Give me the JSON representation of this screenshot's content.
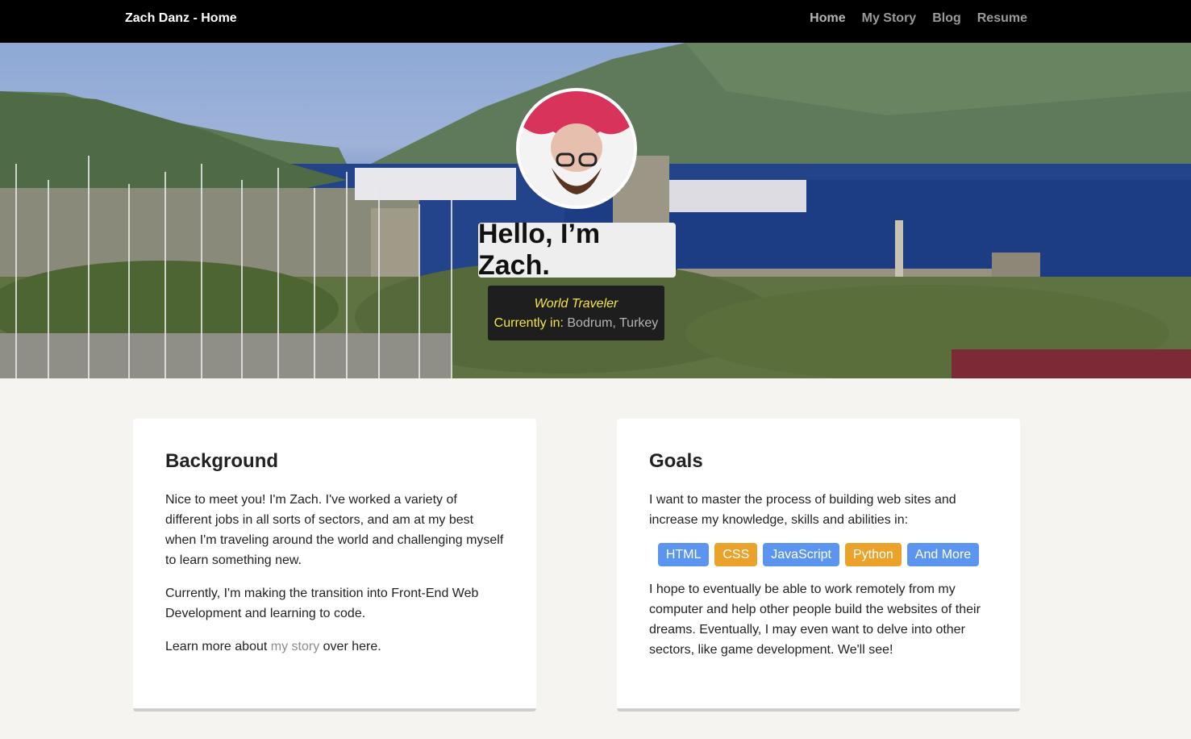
{
  "nav": {
    "brand": "Zach Danz - Home",
    "links": [
      "Home",
      "My Story",
      "Blog",
      "Resume"
    ]
  },
  "hero": {
    "greeting": "Hello, I’m Zach.",
    "role": "World Traveler",
    "location_label": "Currently in:",
    "location_value": "Bodrum, Turkey"
  },
  "background": {
    "title": "Background",
    "paragraphs": [
      "Nice to meet you! I'm Zach. I've worked a variety of different jobs in all sorts of sectors, and am at my best when I'm traveling around the world and challenging myself to learn something new.",
      "Currently, I'm making the transition into Front-End Web Development and learning to code."
    ],
    "more_prefix": "Learn more about ",
    "more_link": "my story",
    "more_suffix": " over here."
  },
  "goals": {
    "title": "Goals",
    "intro": "I want to master the process of building web sites and increase my knowledge, skills and abilities in:",
    "tags": [
      {
        "label": "HTML",
        "color": "#5b95ef"
      },
      {
        "label": "CSS",
        "color": "#eaa22a"
      },
      {
        "label": "JavaScript",
        "color": "#5b95ef"
      },
      {
        "label": "Python",
        "color": "#eaa22a"
      },
      {
        "label": "And More",
        "color": "#5b95ef"
      }
    ],
    "closing": "I hope to eventually be able to work remotely from my computer and help other people build the websites of their dreams. Eventually, I may even want to delve into other sectors, like game development. We'll see!"
  },
  "colors": {
    "navbar": "#000000",
    "accent_yellow": "#f5e642",
    "page_background": "#f5f4f0"
  }
}
